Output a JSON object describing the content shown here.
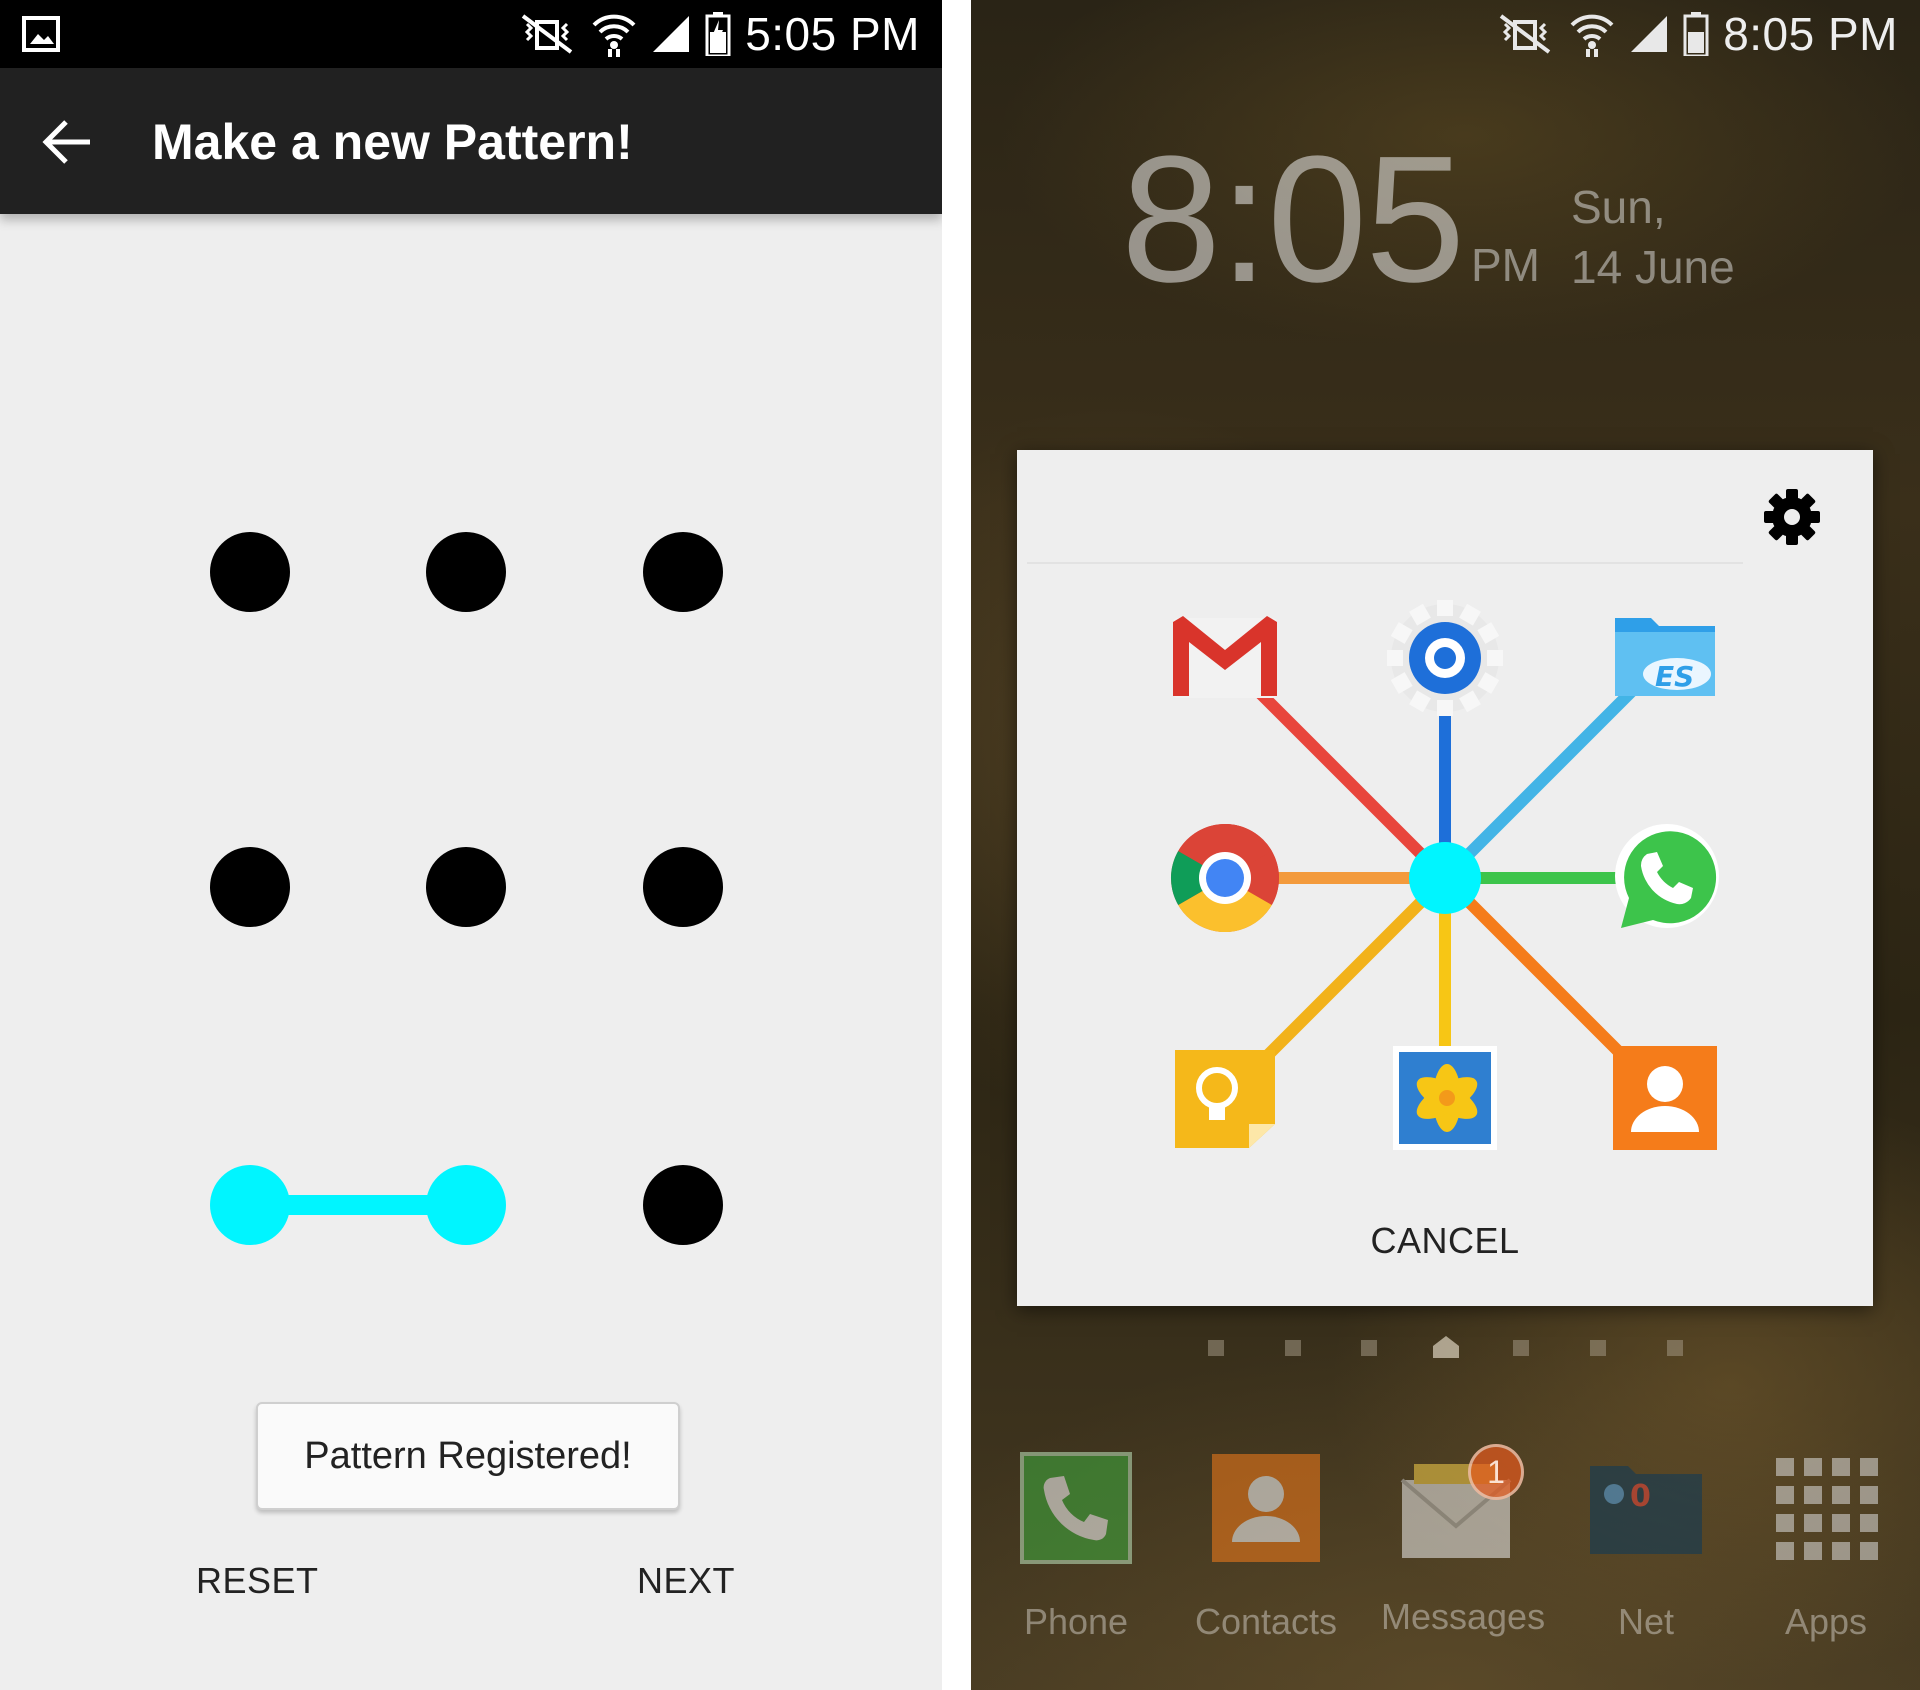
{
  "left": {
    "status": {
      "time": "5:05 PM"
    },
    "appbar": {
      "title": "Make a new Pattern!"
    },
    "pattern": {
      "connected_dots": [
        7,
        8
      ]
    },
    "toast": "Pattern Registered!",
    "buttons": {
      "reset": "RESET",
      "next": "NEXT"
    }
  },
  "right": {
    "status": {
      "time": "8:05 PM"
    },
    "clock": {
      "time": "8:05",
      "ampm": "PM",
      "day": "Sun,",
      "date": "14 June"
    },
    "dialog": {
      "apps": [
        "gmail-icon",
        "settings-app-icon",
        "es-file-explorer-icon",
        "chrome-icon",
        "whatsapp-icon",
        "memo-icon",
        "gallery-icon",
        "contacts-icon"
      ],
      "cancel": "CANCEL",
      "center_color": "#00f5ff"
    },
    "dock": [
      {
        "label": "Phone"
      },
      {
        "label": "Contacts"
      },
      {
        "label": "Messages",
        "badge": "1"
      },
      {
        "label": "Net"
      },
      {
        "label": "Apps"
      }
    ]
  }
}
